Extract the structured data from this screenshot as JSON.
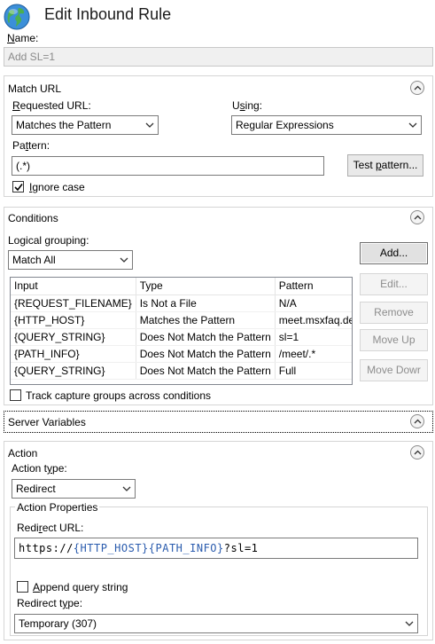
{
  "header": {
    "title": "Edit Inbound Rule",
    "icon": "globe-icon"
  },
  "name": {
    "label": "Name:",
    "value": "Add SL=1"
  },
  "match_url": {
    "title": "Match URL",
    "requested_url_label": "Requested URL:",
    "requested_url_value": "Matches the Pattern",
    "using_label": "Using:",
    "using_value": "Regular Expressions",
    "pattern_label": "Pattern:",
    "pattern_value": "(.*)",
    "test_pattern_button": "Test pattern...",
    "ignore_case_label": "Ignore case",
    "ignore_case_checked": true
  },
  "conditions": {
    "title": "Conditions",
    "logical_grouping_label": "Logical grouping:",
    "logical_grouping_value": "Match All",
    "columns": [
      "Input",
      "Type",
      "Pattern"
    ],
    "rows": [
      {
        "input": "{REQUEST_FILENAME}",
        "type": "Is Not a File",
        "pattern": "N/A"
      },
      {
        "input": "{HTTP_HOST}",
        "type": "Matches the Pattern",
        "pattern": "meet.msxfaq.de"
      },
      {
        "input": "{QUERY_STRING}",
        "type": "Does Not Match the Pattern",
        "pattern": "sl=1"
      },
      {
        "input": "{PATH_INFO}",
        "type": "Does Not Match the Pattern",
        "pattern": "/meet/.*"
      },
      {
        "input": "{QUERY_STRING}",
        "type": "Does Not Match the Pattern",
        "pattern": "Full"
      }
    ],
    "buttons": {
      "add": "Add...",
      "edit": "Edit...",
      "remove": "Remove",
      "move_up": "Move Up",
      "move_down": "Move Dowr"
    },
    "track_label": "Track capture groups across conditions",
    "track_checked": false
  },
  "server_variables": {
    "title": "Server Variables"
  },
  "action": {
    "title": "Action",
    "action_type_label": "Action type:",
    "action_type_value": "Redirect",
    "properties_title": "Action Properties",
    "redirect_url_label": "Redirect URL:",
    "redirect_url_parts": [
      "https://",
      "{HTTP_HOST}",
      "{PATH_INFO}",
      "?sl=1"
    ],
    "append_query_label": "Append query string",
    "append_query_checked": false,
    "redirect_type_label": "Redirect type:",
    "redirect_type_value": "Temporary (307)"
  }
}
